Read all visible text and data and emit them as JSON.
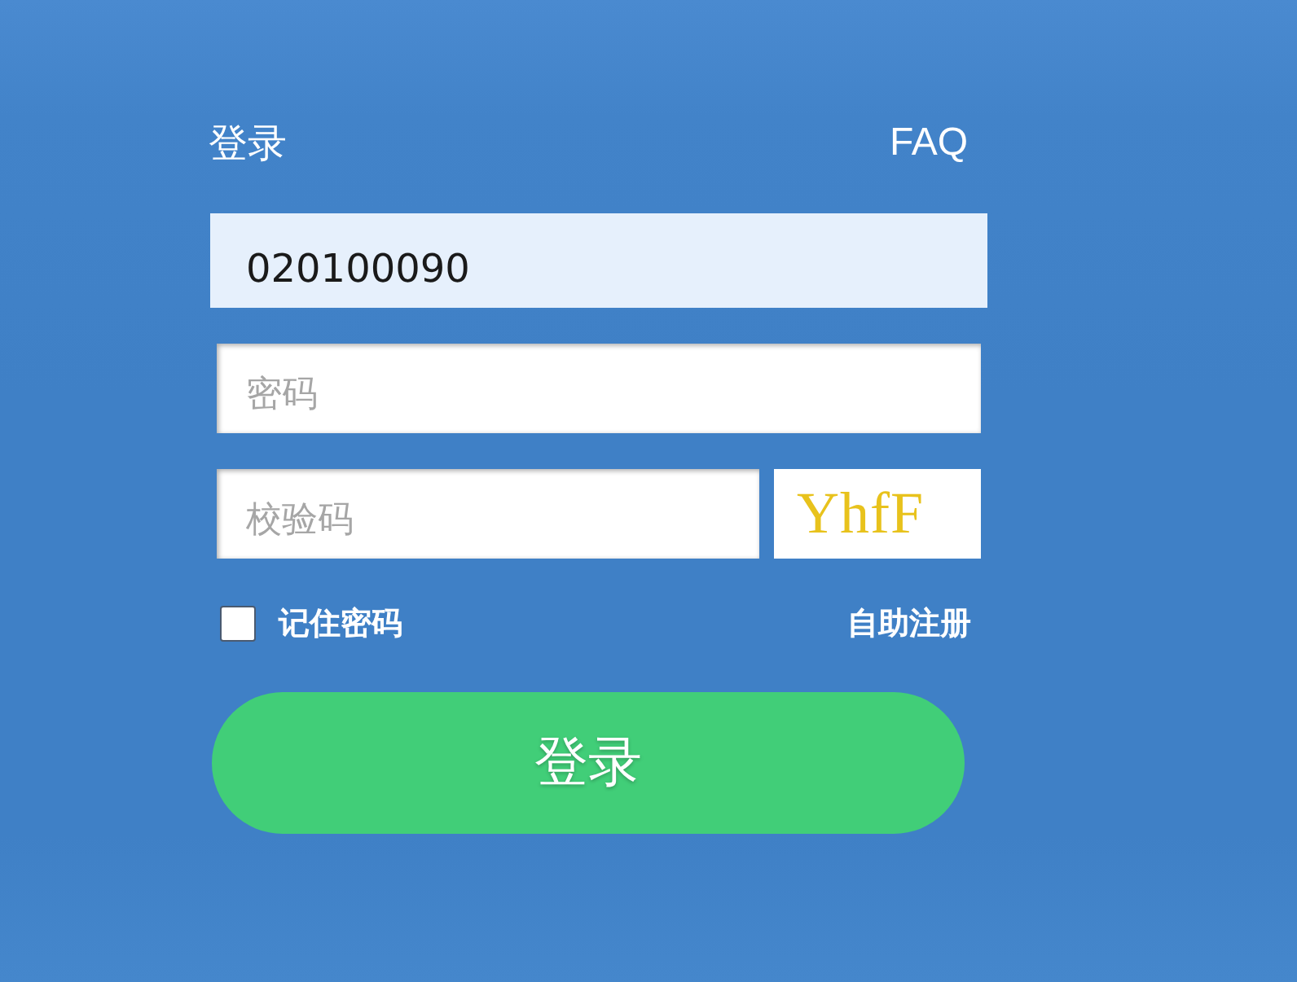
{
  "header": {
    "title": "登录",
    "faq_link": "FAQ"
  },
  "username": {
    "value": "020100090"
  },
  "password": {
    "placeholder": "密码"
  },
  "captcha": {
    "placeholder": "校验码",
    "code": "YhfF"
  },
  "remember": {
    "label": "记住密码",
    "checked": false
  },
  "register_link": "自助注册",
  "submit": {
    "label": "登录"
  }
}
